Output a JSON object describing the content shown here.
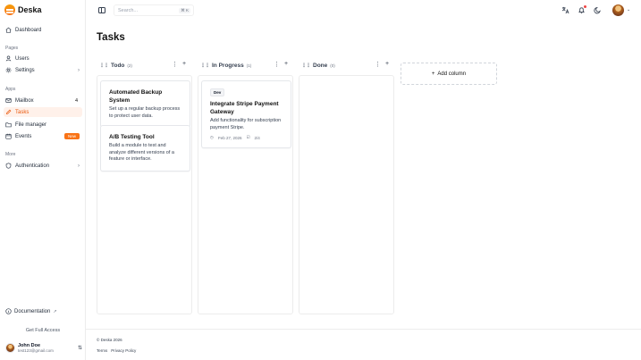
{
  "brand": {
    "name": "Deska"
  },
  "sidebar": {
    "dashboard": "Dashboard",
    "section_pages": "Pages",
    "users": "Users",
    "settings": "Settings",
    "section_apps": "Apps",
    "mailbox": "Mailbox",
    "mailbox_count": "4",
    "tasks": "Tasks",
    "file_manager": "File manager",
    "events": "Events",
    "events_badge": "New",
    "section_more": "More",
    "authentication": "Authentication",
    "documentation": "Documentation",
    "get_full_access": "Get Full Access"
  },
  "user": {
    "name": "John Doe",
    "email": "test123@gmail.com"
  },
  "topbar": {
    "search_placeholder": "Search...",
    "search_shortcut": "⌘ K"
  },
  "page": {
    "title": "Tasks"
  },
  "columns": [
    {
      "title": "Todo",
      "count": "(2)"
    },
    {
      "title": "In Progress",
      "count": "(1)"
    },
    {
      "title": "Done",
      "count": "(0)"
    }
  ],
  "cards": {
    "todo": [
      {
        "title": "Automated Backup System",
        "desc": "Set up a regular backup process to protect user data."
      },
      {
        "title": "A/B Testing Tool",
        "desc": "Build a module to test and analyze different versions of a feature or interface."
      }
    ],
    "progress": [
      {
        "tag": "Dev",
        "title": "Integrate Stripe Payment Gateway",
        "desc": "Add functionality for subscription payment Stripe.",
        "date": "Feb 27, 2026",
        "subtasks": "2/4"
      }
    ]
  },
  "add_column_label": "Add column",
  "footer": {
    "copyright": "© Deska 2026",
    "terms": "Terms",
    "privacy": "Privacy Policy"
  },
  "colors": {
    "accent": "#f97316",
    "active_bg": "#fff1ea"
  }
}
